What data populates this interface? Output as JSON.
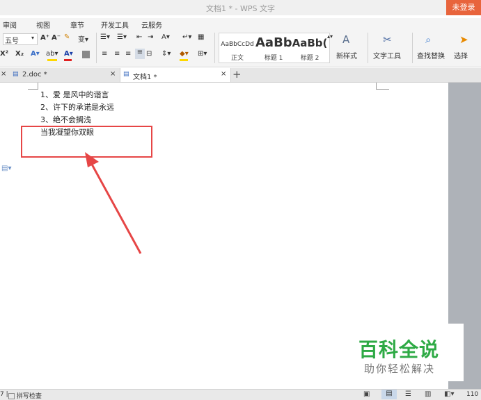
{
  "window": {
    "title": "文档1 * - WPS 文字",
    "login_label": "未登录"
  },
  "menu": [
    "审阅",
    "视图",
    "章节",
    "开发工具",
    "云服务"
  ],
  "ribbon": {
    "font_size": "五号",
    "styles": [
      {
        "sample": "AaBbCcDd",
        "name": "正文"
      },
      {
        "sample": "AaBb",
        "name": "标题 1"
      },
      {
        "sample": "AaBb(",
        "name": "标题 2"
      }
    ],
    "new_style_label": "新样式",
    "text_tools_label": "文字工具",
    "find_replace_label": "查找替换",
    "select_label": "选择"
  },
  "tabs": [
    {
      "label": "2.doc *",
      "active": false
    },
    {
      "label": "文档1 *",
      "active": true
    }
  ],
  "document": {
    "lines": [
      "1、爱 是风中的谐言",
      "2、许下的承诺是永远",
      "3、绝不会搁浅",
      "当我凝望你双眼"
    ]
  },
  "status": {
    "spellcheck_label": "拼写检查",
    "zoom": "110"
  },
  "watermark": {
    "brand": "百科全说",
    "tagline": "助你轻松解决"
  },
  "colors": {
    "accent": "#e8643c",
    "highlight": "#e64646",
    "brand_green": "#2eaa45"
  }
}
